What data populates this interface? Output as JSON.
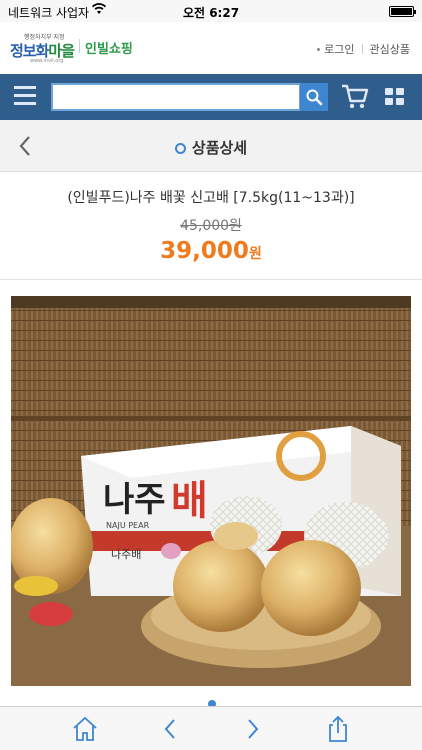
{
  "status_bar": {
    "carrier": "네트워크 사업자",
    "time": "오전 6:27"
  },
  "brand": {
    "logo_small": "행정자치부 지정",
    "logo_main_a": "정보화",
    "logo_main_b": "마을",
    "logo_url": "www.invil.org",
    "shop_name": "인빌쇼핑",
    "login_link": "로그인",
    "wishlist_link": "관심상품"
  },
  "search": {
    "value": "",
    "placeholder": ""
  },
  "title_bar": {
    "title": "상품상세"
  },
  "product": {
    "name": "(인빌푸드)나주 배꽃 신고배 [7.5kg(11~13과)]",
    "original_price": "45,000원",
    "sale_price": "39,000",
    "sale_unit": "원",
    "photo_box_brand": "나주",
    "photo_box_word": "배",
    "photo_box_sub": "NAJU PEAR",
    "photo_box_small": "나주배"
  },
  "colors": {
    "nav_blue": "#2f5d8c",
    "accent_blue": "#3f86d0",
    "price_orange": "#f07a1e",
    "brand_green": "#2c9a4a"
  },
  "icons": {
    "menu": "hamburger-icon",
    "search": "search-icon",
    "cart": "cart-icon",
    "grid": "grid-icon",
    "back": "chevron-left-icon",
    "home": "home-icon",
    "prev": "chevron-left-icon",
    "next": "chevron-right-icon",
    "share": "share-icon"
  }
}
